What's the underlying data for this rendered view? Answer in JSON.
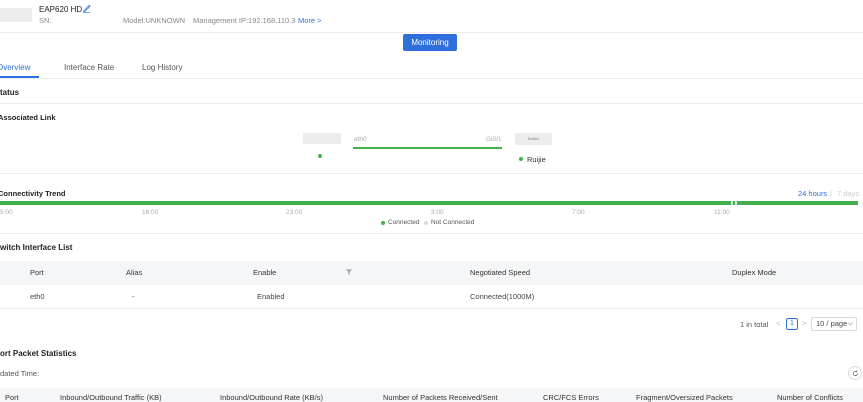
{
  "header": {
    "device_name": "EAP620 HD",
    "sn_label": "SN:",
    "model": "Model:UNKNOWN",
    "mgmt_ip": "Management IP:192.168.110.3",
    "more_link": "More >",
    "monitor_button": "Monitoring"
  },
  "tabs": [
    {
      "label": "Overview",
      "active": true
    },
    {
      "label": "Interface Rate",
      "active": false
    },
    {
      "label": "Log History",
      "active": false
    }
  ],
  "status": {
    "title": "tatus"
  },
  "associated_link": {
    "title": "Associated Link",
    "ap_port": "eth0",
    "switch_port": "Gi0/1",
    "switch_label": "Switch",
    "switch_name": "Ruijie",
    "link_color": "#43b14b"
  },
  "trend": {
    "title": "Connectivity Trend",
    "range_24h": "24 hours",
    "range_sep": "|",
    "range_7d": "7 days",
    "ticks": [
      "5:00",
      "16:00",
      "23:00",
      "3:00",
      "7:00",
      "11:00"
    ],
    "legend_connected": "Connected",
    "legend_not_connected": "Not Connected",
    "connected_color": "#43b14b",
    "not_connected_color": "#d9d9d9"
  },
  "switch_interfaces": {
    "title": "witch Interface List",
    "columns": [
      "Port",
      "Alias",
      "Enable",
      "Negotiated Speed",
      "Duplex Mode"
    ],
    "rows": [
      {
        "port": "eth0",
        "alias": "-",
        "enable": "Enabled",
        "speed": "Connected(1000M)",
        "duplex": ""
      }
    ]
  },
  "pagination": {
    "total": "1 in total",
    "prev": "<",
    "current": "1",
    "next": ">",
    "page_size": "10 / page"
  },
  "port_stats": {
    "title": "ort Packet Statistics",
    "updated": "dated Time:",
    "columns": [
      "Port",
      "Inbound/Outbound Traffic (KB)",
      "Inbound/Outbound Rate (KB/s)",
      "Number of Packets Received/Sent",
      "CRC/FCS Errors",
      "Fragment/Oversized Packets",
      "Number of Conflicts"
    ]
  },
  "accent_color": "#2f6fdb"
}
